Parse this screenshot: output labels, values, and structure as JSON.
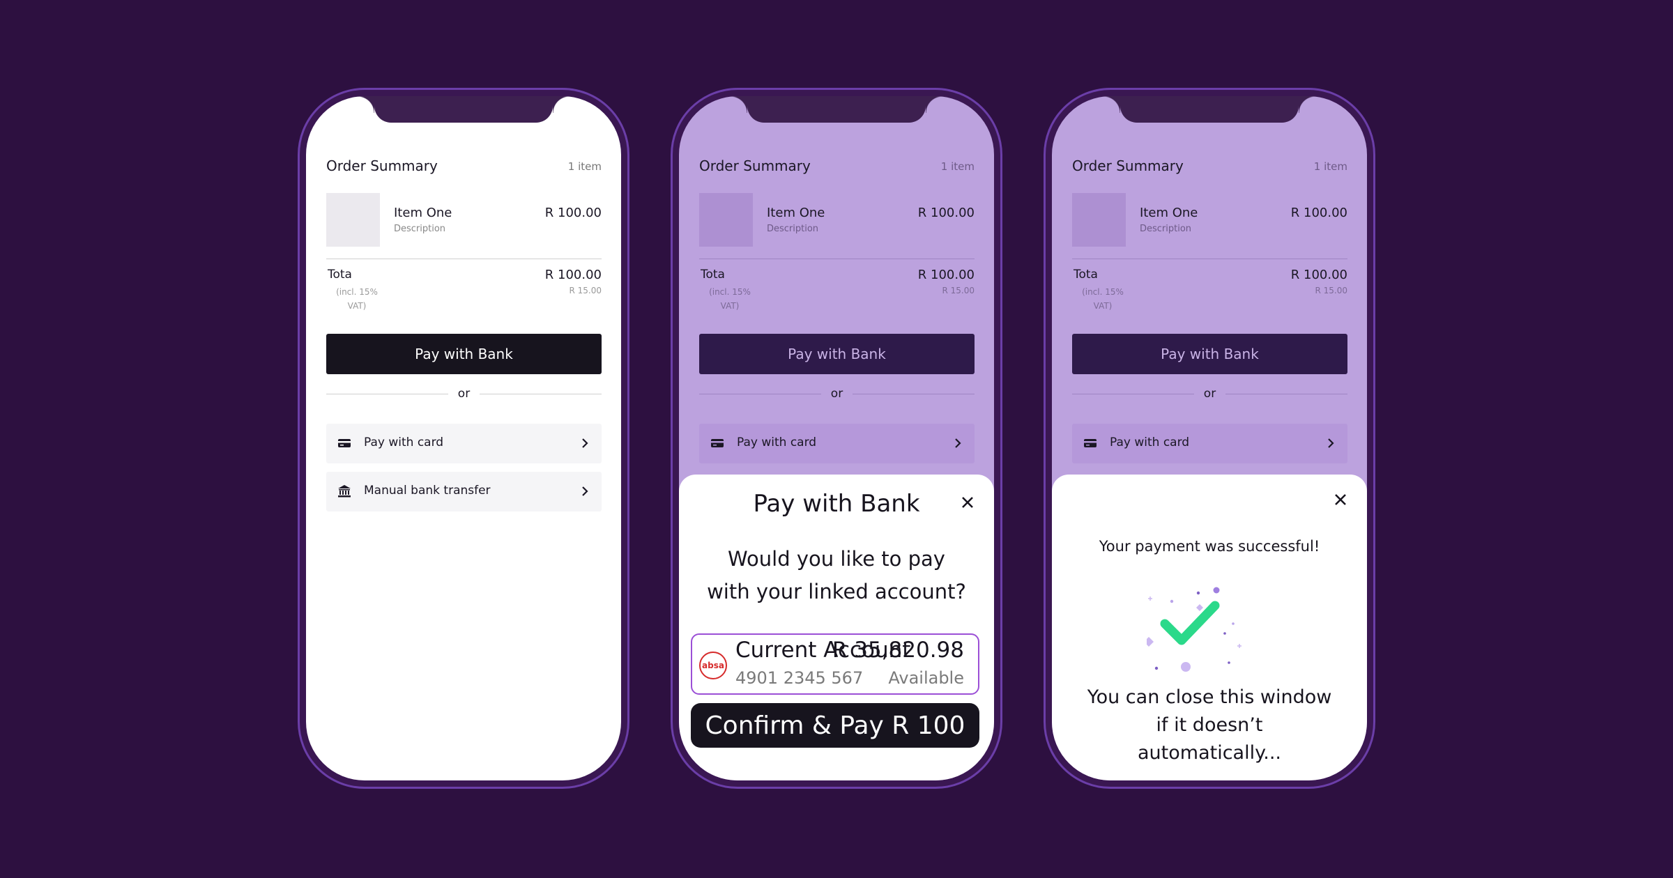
{
  "order": {
    "title": "Order Summary",
    "count": "1 item",
    "item_name": "Item One",
    "item_desc": "Description",
    "item_price": "R 100.00",
    "total_label": "Tota",
    "total_price": "R 100.00",
    "vat_label": "(incl. 15% VAT)",
    "vat_value": "R 15.00",
    "pay_bank_label": "Pay with Bank",
    "or_label": "or",
    "pay_card_label": "Pay with card",
    "manual_transfer_label": "Manual bank transfer"
  },
  "sheet": {
    "title": "Pay with Bank",
    "question": "Would you like to pay with your linked account?",
    "account_name": "Current Account",
    "account_balance": "R 35,820.98",
    "account_number": "4901 2345 567",
    "available_label": "Available",
    "bank_logo_text": "absa",
    "confirm_label": "Confirm & Pay R 100"
  },
  "success": {
    "message": "Your payment was successful!",
    "close_message": "You can close this window if it doesn’t automatically..."
  },
  "colors": {
    "background": "#2d1040",
    "accent": "#9b4fd6",
    "check": "#2bd98a",
    "overlay": "#bca2de",
    "dark_button": "#17141e"
  },
  "icons": [
    "credit-card-icon",
    "bank-icon",
    "chevron-right-icon",
    "close-icon",
    "success-check-icon"
  ]
}
